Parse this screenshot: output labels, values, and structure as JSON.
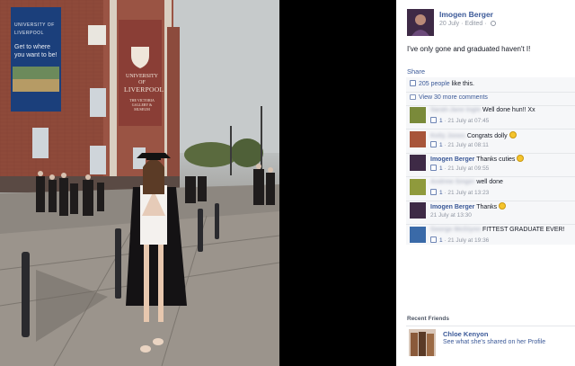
{
  "photo": {
    "banner": {
      "university": "UNIVERSITY OF LIVERPOOL",
      "slogan": "Get to where you want to be!"
    },
    "sign": {
      "line1": "UNIVERSITY OF",
      "line2": "LIVERPOOL",
      "sub": "THE VICTORIA GALLERY & MUSEUM"
    }
  },
  "post": {
    "author": "Imogen Berger",
    "date": "20 July",
    "edited": "· Edited ·",
    "text": "I've only gone and graduated haven't I!",
    "share_label": "Share"
  },
  "ufi": {
    "likes_link": "205 people",
    "likes_suffix": " like this.",
    "view_more": "View 30 more comments"
  },
  "comments": [
    {
      "name": "Sarah-Jane Ingle",
      "blurred": true,
      "text": " Well done hun!! Xx",
      "likes": "1",
      "time": " · 21 July at 07:45",
      "avatar_color": "#7a8a3a"
    },
    {
      "name": "Kelly Jones",
      "blurred": true,
      "text": " Congrats dolly ",
      "emoji": true,
      "likes": "1",
      "time": " · 21 July at 08:11",
      "avatar_color": "#a8553a"
    },
    {
      "name": "Imogen Berger",
      "blurred": false,
      "text": " Thanks cuties ",
      "emoji": true,
      "likes": "1",
      "time": " · 21 July at 09:55",
      "avatar_color": "#3e2a46"
    },
    {
      "name": "Andrew Singer",
      "blurred": true,
      "text": " well done",
      "likes": "1",
      "time": " · 21 July at 13:23",
      "avatar_color": "#8f9a3c"
    },
    {
      "name": "Imogen Berger",
      "blurred": false,
      "text": " Thanks ",
      "emoji": true,
      "likes": "",
      "time": "21 July at 13:30",
      "avatar_color": "#3e2a46"
    },
    {
      "name": "George McGlynn",
      "blurred": true,
      "text": " FITTEST GRADUATE EVER!",
      "likes": "1",
      "time": " · 21 July at 19:36",
      "avatar_color": "#3a6aa8"
    }
  ],
  "recent_friends": {
    "title": "Recent Friends",
    "name": "Chloe Kenyon",
    "link": "See what she's shared on her Profile"
  },
  "colors": {
    "link": "#3b5998",
    "muted": "#9197a3",
    "ufi_bg": "#f6f7f9"
  }
}
